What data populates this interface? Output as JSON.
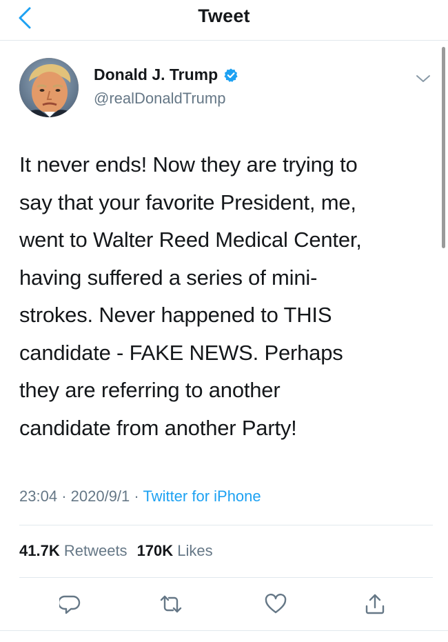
{
  "header": {
    "title": "Tweet",
    "back_icon": "chevron-left-icon"
  },
  "author": {
    "name": "Donald J. Trump",
    "handle": "@realDonaldTrump",
    "verified_icon": "verified-badge-icon",
    "menu_icon": "chevron-down-icon"
  },
  "tweet": {
    "lines": [
      "It never ends! Now they are trying to",
      "say that your favorite President, me,",
      "went to Walter Reed Medical Center,",
      "having suffered a series of mini-",
      "strokes. Never happened to THIS",
      "candidate - FAKE NEWS. Perhaps",
      "they are referring to another",
      "candidate from another Party!"
    ]
  },
  "meta": {
    "time": "23:04",
    "separator": "·",
    "date": "2020/9/1",
    "source": "Twitter for iPhone"
  },
  "stats": {
    "retweets_count": "41.7K",
    "retweets_label": "Retweets",
    "likes_count": "170K",
    "likes_label": "Likes"
  },
  "actions": {
    "reply_icon": "reply-icon",
    "retweet_icon": "retweet-icon",
    "like_icon": "heart-icon",
    "share_icon": "share-icon"
  },
  "colors": {
    "accent": "#1da1f2",
    "text": "#14171a",
    "secondary": "#657786",
    "divider": "#e1e8ed"
  }
}
